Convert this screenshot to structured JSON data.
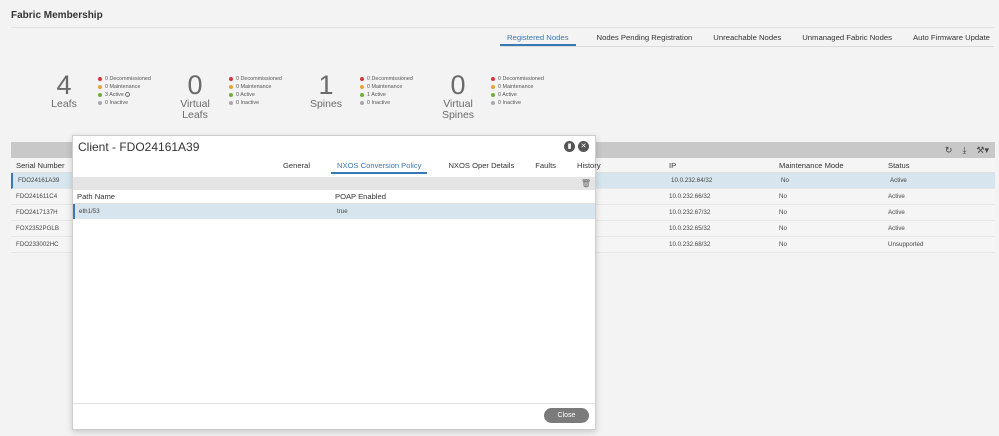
{
  "page": {
    "title": "Fabric Membership"
  },
  "tabs": [
    {
      "label": "Registered Nodes",
      "active": true
    },
    {
      "label": "Nodes Pending Registration",
      "active": false
    },
    {
      "label": "Unreachable Nodes",
      "active": false
    },
    {
      "label": "Unmanaged Fabric Nodes",
      "active": false
    },
    {
      "label": "Auto Firmware Update",
      "active": false
    }
  ],
  "summary": [
    {
      "count": "4",
      "label1": "Leafs",
      "label2": "",
      "legend": [
        "0 Decommissioned",
        "0 Maintenance",
        "3 Active",
        "0 Inactive"
      ]
    },
    {
      "count": "0",
      "label1": "Virtual",
      "label2": "Leafs",
      "legend": [
        "0 Decommissioned",
        "0 Maintenance",
        "0 Active",
        "0 Inactive"
      ]
    },
    {
      "count": "1",
      "label1": "Spines",
      "label2": "",
      "legend": [
        "0 Decommissioned",
        "0 Maintenance",
        "1 Active",
        "0 Inactive"
      ]
    },
    {
      "count": "0",
      "label1": "Virtual",
      "label2": "Spines",
      "legend": [
        "0 Decommissioned",
        "0 Maintenance",
        "0 Active",
        "0 Inactive"
      ]
    }
  ],
  "legend_colors": {
    "decommissioned": "#d0393b",
    "maintenance": "#e5a33b",
    "active": "#6fae3f",
    "inactive": "#a8a8a8"
  },
  "grid": {
    "columns": {
      "serial": "Serial Number",
      "ip": "IP",
      "maint": "Maintenance Mode",
      "status": "Status"
    },
    "rows": [
      {
        "serial": "FDO24161A39",
        "ip": "10.0.232.64/32",
        "maint": "No",
        "status": "Active"
      },
      {
        "serial": "FDO241611C4",
        "ip": "10.0.232.66/32",
        "maint": "No",
        "status": "Active"
      },
      {
        "serial": "FDO2417137H",
        "ip": "10.0.232.67/32",
        "maint": "No",
        "status": "Active"
      },
      {
        "serial": "FOX2352PGLB",
        "ip": "10.0.232.65/32",
        "maint": "No",
        "status": "Active"
      },
      {
        "serial": "FDO233002HC",
        "ip": "10.0.232.68/32",
        "maint": "No",
        "status": "Unsupported"
      }
    ],
    "toolbar_icons": [
      "refresh-icon",
      "download-icon",
      "tools-icon"
    ]
  },
  "modal": {
    "title": "Client - FDO24161A39",
    "tabs": [
      {
        "label": "General",
        "active": false
      },
      {
        "label": "NXOS Conversion Policy",
        "active": true
      },
      {
        "label": "NXOS Oper Details",
        "active": false
      },
      {
        "label": "Faults",
        "active": false
      },
      {
        "label": "History",
        "active": false
      }
    ],
    "columns": {
      "path": "Path Name",
      "poap": "POAP Enabled"
    },
    "rows": [
      {
        "path": "eth1/53",
        "poap": "true"
      }
    ],
    "close_label": "Close"
  },
  "accent": "#3a78b5"
}
